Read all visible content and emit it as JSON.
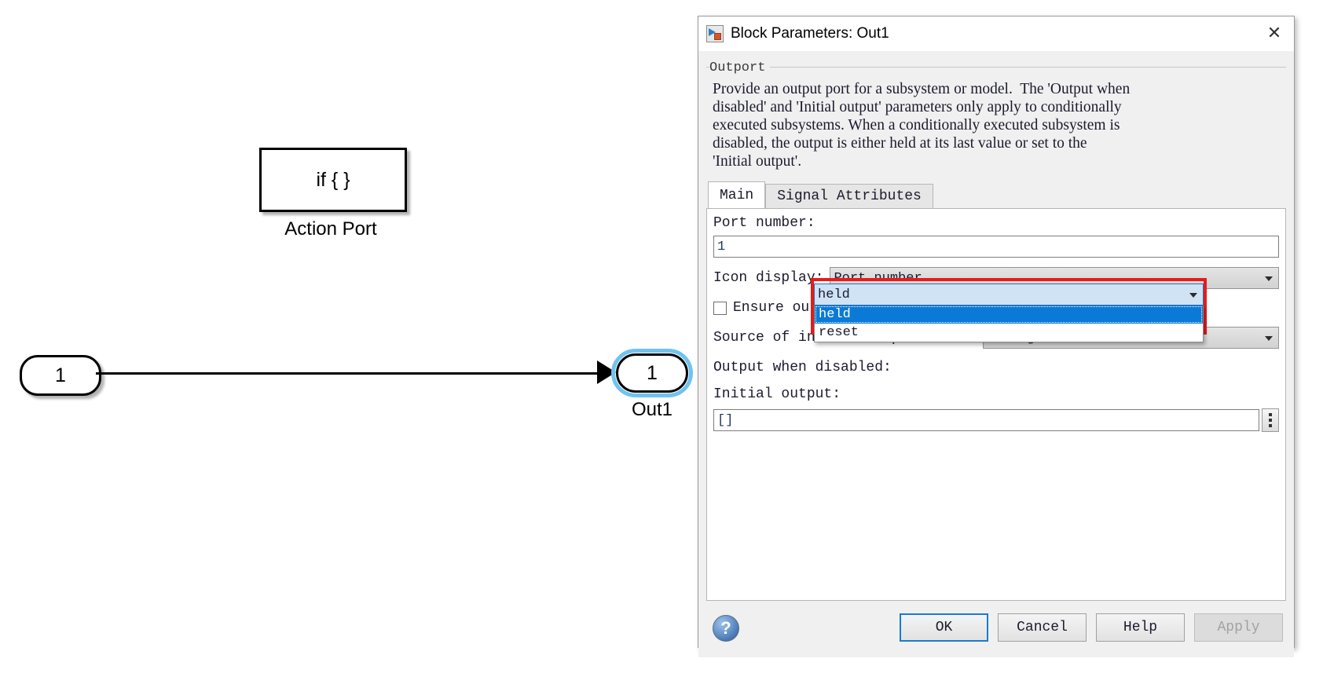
{
  "canvas": {
    "action_port_block": {
      "icon_text": "if { }",
      "label": "Action Port"
    },
    "inport_block": {
      "number": "1"
    },
    "outport_block": {
      "number": "1",
      "label": "Out1"
    }
  },
  "dialog": {
    "title": "Block Parameters: Out1",
    "title_icon": "simulink-block-icon",
    "close_icon": "✕",
    "group_legend": "Outport",
    "description": "Provide an output port for a subsystem or model.  The 'Output when\ndisabled' and 'Initial output' parameters only apply to conditionally\nexecuted subsystems. When a conditionally executed subsystem is\ndisabled, the output is either held at its last value or set to the\n'Initial output'.",
    "tabs": [
      {
        "label": "Main",
        "active": true
      },
      {
        "label": "Signal Attributes",
        "active": false
      }
    ],
    "fields": {
      "port_number": {
        "label": "Port number:",
        "value": "1"
      },
      "icon_display": {
        "label": "Icon display:",
        "value": "Port number"
      },
      "ensure_virtual": {
        "label": "Ensure outport is virtual",
        "checked": false
      },
      "source_initial_output": {
        "label": "Source of initial output value:",
        "value": "Dialog"
      },
      "output_when_disabled": {
        "label": "Output when disabled:",
        "value": "held",
        "open": true,
        "options": [
          {
            "label": "held",
            "selected": true
          },
          {
            "label": "reset",
            "selected": false
          }
        ]
      },
      "initial_output": {
        "label": "Initial output:",
        "value": "[]",
        "picker_icon": "vertical-dots-icon"
      }
    },
    "footer": {
      "help_icon": "?",
      "buttons": [
        {
          "label": "OK",
          "state": "focused"
        },
        {
          "label": "Cancel",
          "state": "normal"
        },
        {
          "label": "Help",
          "state": "normal"
        },
        {
          "label": "Apply",
          "state": "disabled"
        }
      ]
    }
  },
  "colors": {
    "highlight_box": "#e51c1c",
    "selection_blue": "#0b7ad6",
    "combo_active_bg": "#cfe3f5",
    "block_halo": "#6fc3f0"
  }
}
